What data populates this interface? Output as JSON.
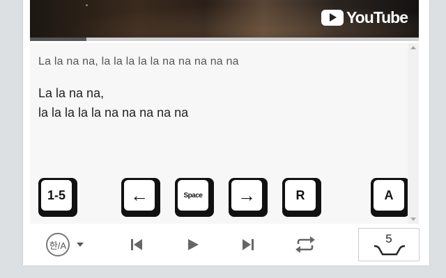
{
  "video": {
    "brand": "YouTube",
    "progress_fraction": 0.145
  },
  "lyrics": {
    "preview_line": "La la na na, la la la la la na na na na na",
    "current_line_1": "La la na na,",
    "current_line_2": "la la la la la na na na na na"
  },
  "shortcut_keys": [
    {
      "id": "1-5",
      "label": "1-5"
    },
    {
      "id": "left",
      "label": "←"
    },
    {
      "id": "space",
      "label": "Space"
    },
    {
      "id": "right",
      "label": "→"
    },
    {
      "id": "r",
      "label": "R"
    },
    {
      "id": "a",
      "label": "A"
    }
  ],
  "toolbar": {
    "lang_label": "한/A",
    "speed_value": "5"
  }
}
